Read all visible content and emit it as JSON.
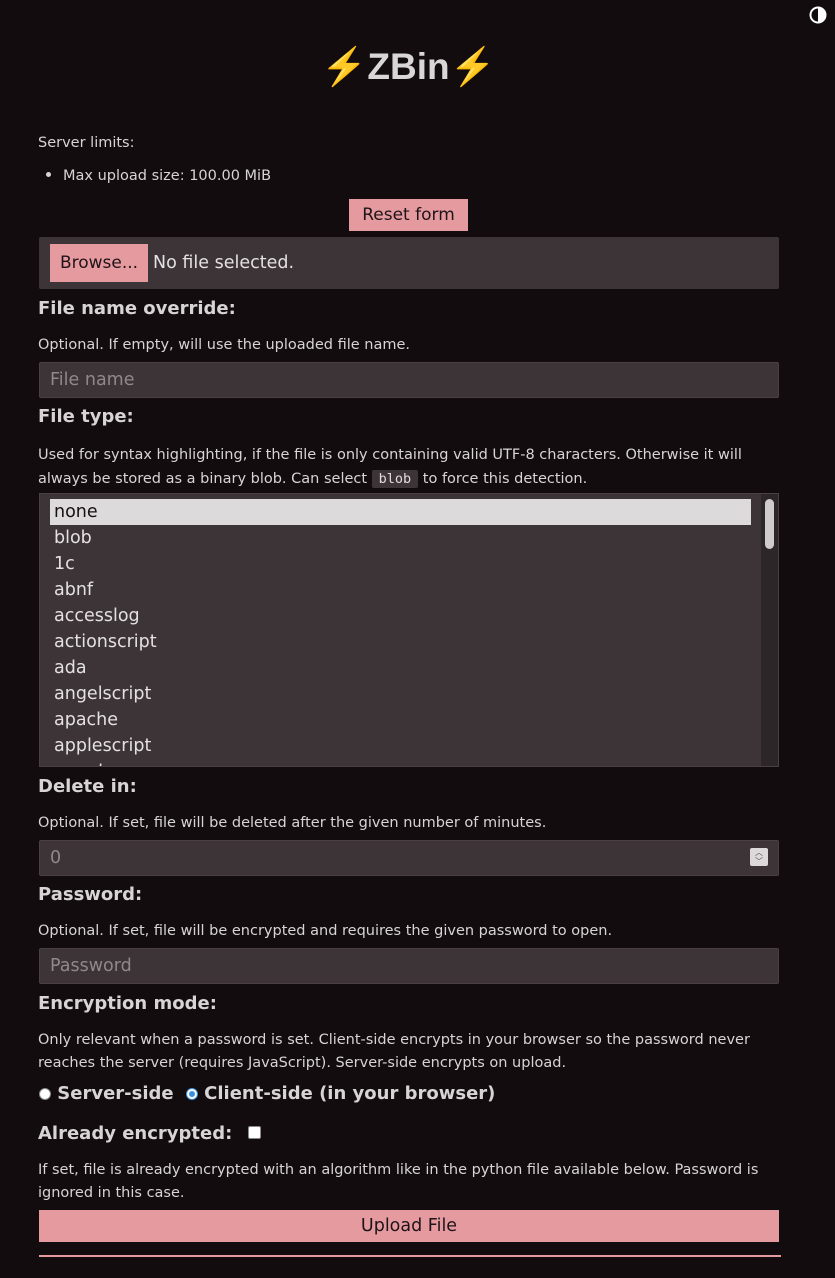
{
  "header": {
    "title_prefix": "⚡",
    "title": "ZBin",
    "title_suffix": "⚡",
    "theme_toggle_icon": "contrast-icon"
  },
  "limits": {
    "label": "Server limits:",
    "items": [
      "Max upload size: 100.00 MiB"
    ]
  },
  "form": {
    "reset_label": "Reset form",
    "file_picker": {
      "browse_label": "Browse...",
      "status": "No file selected."
    },
    "file_name": {
      "heading": "File name override:",
      "help": "Optional. If empty, will use the uploaded file name.",
      "placeholder": "File name",
      "value": ""
    },
    "file_type": {
      "heading": "File type:",
      "help_before": "Used for syntax highlighting, if the file is only containing valid UTF-8 characters. Otherwise it will always be stored as a binary blob. Can select ",
      "help_code": "blob",
      "help_after": " to force this detection.",
      "selected": "none",
      "options": [
        "none",
        "blob",
        "1c",
        "abnf",
        "accesslog",
        "actionscript",
        "ada",
        "angelscript",
        "apache",
        "applescript",
        "arcade"
      ]
    },
    "delete_in": {
      "heading": "Delete in:",
      "help": "Optional. If set, file will be deleted after the given number of minutes.",
      "placeholder": "0",
      "value": ""
    },
    "password": {
      "heading": "Password:",
      "help": "Optional. If set, file will be encrypted and requires the given password to open.",
      "placeholder": "Password",
      "value": ""
    },
    "encryption_mode": {
      "heading": "Encryption mode:",
      "help": "Only relevant when a password is set. Client-side encrypts in your browser so the password never reaches the server (requires JavaScript). Server-side encrypts on upload.",
      "options": [
        "Server-side",
        "Client-side (in your browser)"
      ],
      "selected": "Client-side (in your browser)"
    },
    "already_encrypted": {
      "label": "Already encrypted:",
      "checked": false,
      "help": "If set, file is already encrypted with an algorithm like in the python file available below. Password is ignored in this case."
    },
    "upload_label": "Upload File"
  },
  "colors": {
    "background": "#120c0f",
    "accent": "#e59aa0",
    "input_bg": "#3d3438",
    "radio_selected": "#3b8fe0",
    "bolt": "#f2c12e"
  }
}
